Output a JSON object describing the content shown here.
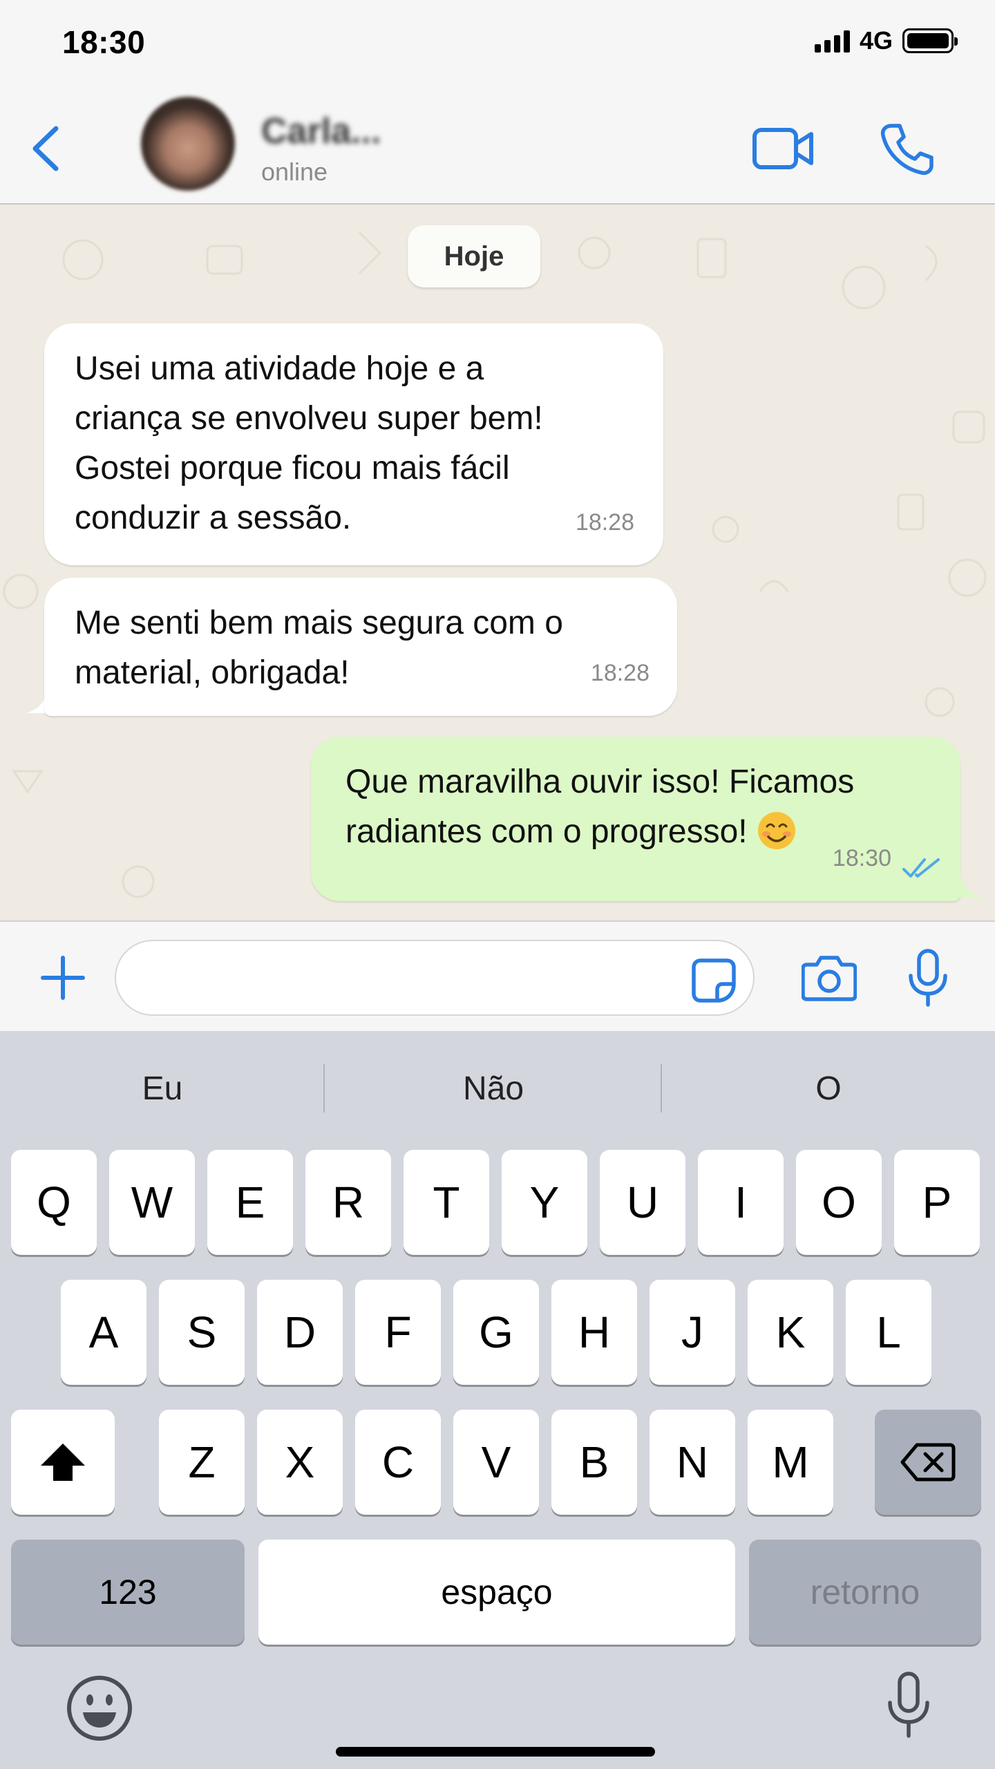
{
  "status_bar": {
    "time": "18:30",
    "network": "4G"
  },
  "header": {
    "contact_name": "Carla...",
    "contact_status": "online",
    "icons": {
      "back": "chevron-left-icon",
      "video": "video-camera-icon",
      "call": "phone-icon"
    },
    "accent_color": "#2a7de1"
  },
  "chat": {
    "date_label": "Hoje",
    "messages": [
      {
        "direction": "incoming",
        "text": "Usei uma atividade hoje e a\ncriança se envolveu super bem!\nGostei porque ficou mais fácil\nconduzir a sessão.",
        "time": "18:28"
      },
      {
        "direction": "incoming",
        "text": "Me senti bem mais segura com o\nmaterial, obrigada!",
        "time": "18:28"
      },
      {
        "direction": "outgoing",
        "text": "Que maravilha ouvir isso! Ficamos\nradiantes com o progresso!",
        "emoji": "smiling-face-emoji",
        "time": "18:30",
        "status": "read"
      }
    ],
    "colors": {
      "incoming": "#ffffff",
      "outgoing": "#dcf8c6",
      "background": "#efeae2",
      "read_ticks": "#4fa8e8"
    }
  },
  "input_bar": {
    "message_value": "",
    "icons": {
      "attach": "plus-icon",
      "sticker": "sticker-icon",
      "camera": "camera-icon",
      "voice": "microphone-icon"
    }
  },
  "keyboard": {
    "suggestions": [
      "Eu",
      "Não",
      "O"
    ],
    "rows": [
      [
        "Q",
        "W",
        "E",
        "R",
        "T",
        "Y",
        "U",
        "I",
        "O",
        "P"
      ],
      [
        "A",
        "S",
        "D",
        "F",
        "G",
        "H",
        "J",
        "K",
        "L"
      ],
      [
        "Z",
        "X",
        "C",
        "V",
        "B",
        "N",
        "M"
      ]
    ],
    "numbers_key": "123",
    "space_key": "espaço",
    "return_key": "retorno",
    "icons": {
      "shift": "shift-arrow-icon",
      "delete": "backspace-icon",
      "emoji": "emoji-icon",
      "dictation": "microphone-icon"
    }
  }
}
